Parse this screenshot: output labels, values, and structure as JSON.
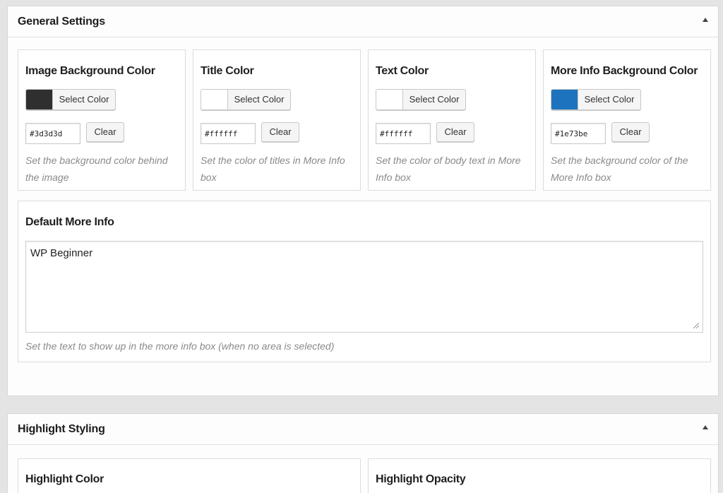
{
  "general": {
    "title": "General Settings",
    "cards": [
      {
        "title": "Image Background Color",
        "button": "Select Color",
        "swatch": "#2f2f2f",
        "hex": "#3d3d3d",
        "clear": "Clear",
        "desc": "Set the background color behind the image"
      },
      {
        "title": "Title Color",
        "button": "Select Color",
        "swatch": "#ffffff",
        "hex": "#ffffff",
        "clear": "Clear",
        "desc": "Set the color of titles in More Info box"
      },
      {
        "title": "Text Color",
        "button": "Select Color",
        "swatch": "#ffffff",
        "hex": "#ffffff",
        "clear": "Clear",
        "desc": "Set the color of body text in More Info box"
      },
      {
        "title": "More Info Background Color",
        "button": "Select Color",
        "swatch": "#1e73be",
        "hex": "#1e73be",
        "clear": "Clear",
        "desc": "Set the background color of the More Info box"
      }
    ],
    "default_more_info": {
      "title": "Default More Info",
      "value": "WP Beginner",
      "desc": "Set the text to show up in the more info box (when no area is selected)"
    }
  },
  "highlight": {
    "title": "Highlight Styling",
    "cards": [
      {
        "title": "Highlight Color"
      },
      {
        "title": "Highlight Opacity"
      }
    ]
  },
  "icons": {
    "collapse": "triangle-up-icon",
    "resize": "resize-handle-icon"
  }
}
